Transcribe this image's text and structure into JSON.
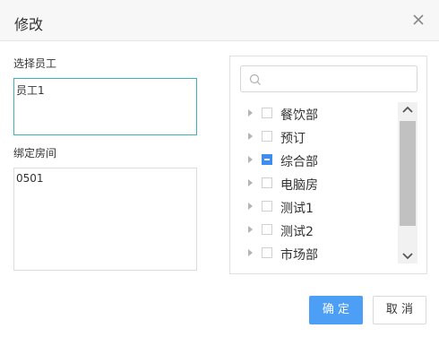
{
  "dialog": {
    "title": "修改"
  },
  "form": {
    "employee_label": "选择员工",
    "employee_value": "员工1",
    "room_label": "绑定房间",
    "room_value": "0501"
  },
  "tree": {
    "search_placeholder": "",
    "items": [
      {
        "label": "餐饮部",
        "state": "unchecked"
      },
      {
        "label": "预订",
        "state": "unchecked"
      },
      {
        "label": "综合部",
        "state": "indeterminate"
      },
      {
        "label": "电脑房",
        "state": "unchecked"
      },
      {
        "label": "测试1",
        "state": "unchecked"
      },
      {
        "label": "测试2",
        "state": "unchecked"
      },
      {
        "label": "市场部",
        "state": "unchecked"
      }
    ]
  },
  "buttons": {
    "ok_label": "确 定",
    "cancel_label": "取 消"
  },
  "colors": {
    "primary": "#4d9ff5",
    "focus_border": "#3fb1b8",
    "checkbox_active": "#3d8ef0"
  },
  "icons": {
    "close": "close-icon",
    "search": "search-icon",
    "expand": "caret-right-icon"
  }
}
